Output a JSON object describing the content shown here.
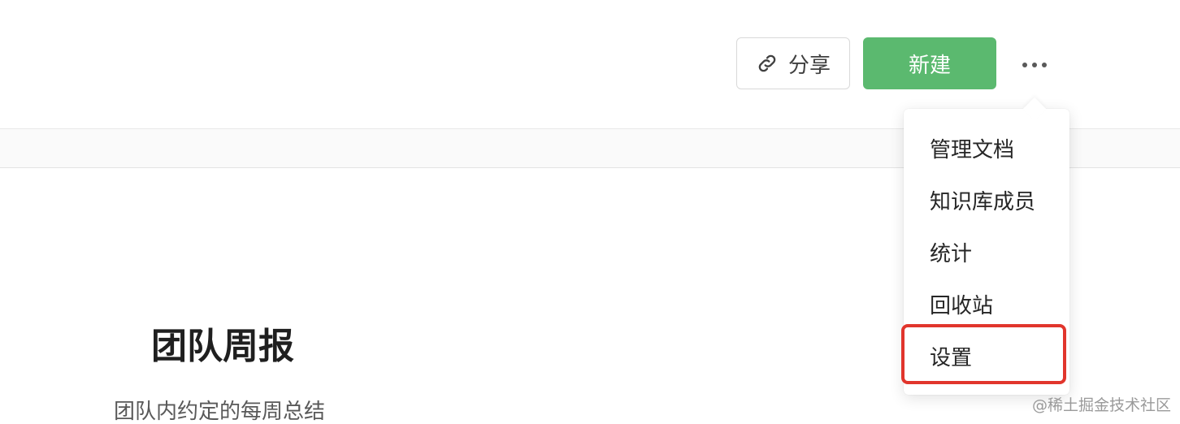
{
  "header": {
    "share_label": "分享",
    "new_label": "新建",
    "more_icon": "more-horizontal-icon",
    "link_icon": "link-icon",
    "new_button_color": "#5bb96f"
  },
  "menu": {
    "items": [
      {
        "label": "管理文档"
      },
      {
        "label": "知识库成员"
      },
      {
        "label": "统计"
      },
      {
        "label": "回收站"
      },
      {
        "label": "设置"
      }
    ],
    "highlight_color": "#e1352c",
    "highlighted_item": "设置"
  },
  "document": {
    "title": "团队周报",
    "description": "团队内约定的每周总结"
  },
  "watermark": "@稀土掘金技术社区"
}
